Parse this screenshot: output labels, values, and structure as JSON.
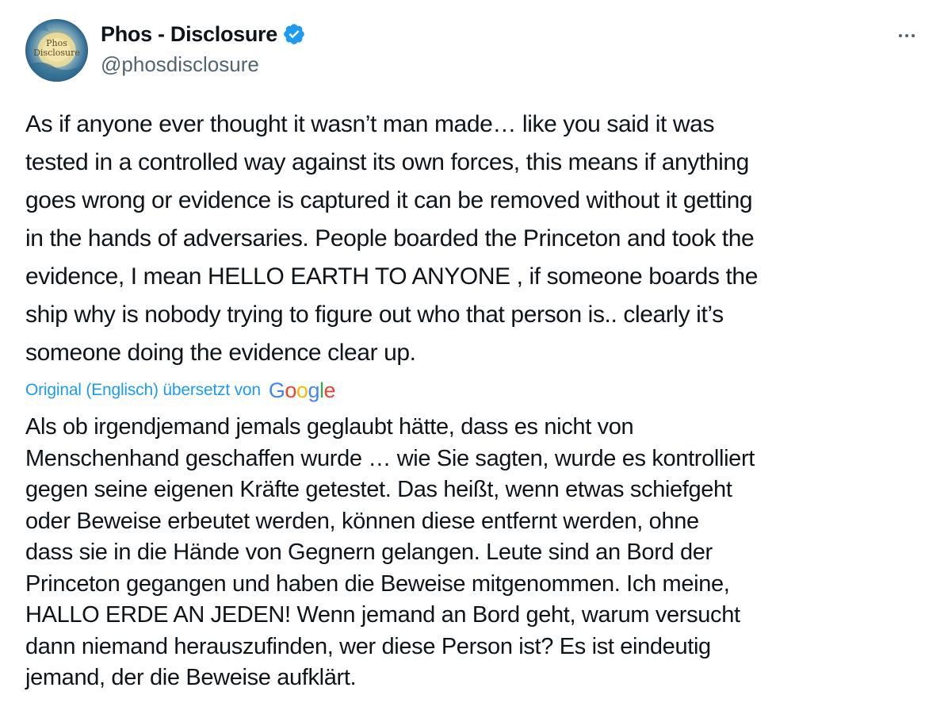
{
  "author": {
    "display_name": "Phos - Disclosure",
    "handle": "@phosdisclosure",
    "avatar_text_line1": "Phos",
    "avatar_text_line2": "Disclosure",
    "verified": true,
    "verified_icon": "verified-badge-icon",
    "verified_color": "#1d9bf0"
  },
  "menu": {
    "icon": "more-options-icon"
  },
  "tweet": {
    "original_text": "As if anyone ever thought it wasn’t man made… like you said it was\ntested in a controlled way against its own forces, this means if anything\ngoes wrong or evidence is captured it can be removed without it getting\nin the hands of adversaries. People boarded the Princeton and took the\nevidence, I mean HELLO EARTH TO ANYONE , if someone boards the\nship why is nobody trying to figure out who that person is.. clearly it’s\nsomeone doing the evidence clear up.",
    "translation_label": "Original (Englisch) übersetzt von",
    "translation_provider": [
      "G",
      "o",
      "o",
      "g",
      "l",
      "e"
    ],
    "translation_provider_colors": [
      "#4285f4",
      "#ea4335",
      "#fbbc05",
      "#4285f4",
      "#34a853",
      "#ea4335"
    ],
    "translated_text": "Als ob irgendjemand jemals geglaubt hätte, dass es nicht von\nMenschenhand geschaffen wurde … wie Sie sagten, wurde es kontrolliert\ngegen seine eigenen Kräfte getestet. Das heißt, wenn etwas schiefgeht\noder Beweise erbeutet werden, können diese entfernt werden, ohne\ndass sie in die Hände von Gegnern gelangen. Leute sind an Bord der\nPrinceton gegangen und haben die Beweise mitgenommen. Ich meine,\nHALLO ERDE AN JEDEN! Wenn jemand an Bord geht, warum versucht\ndann niemand herauszufinden, wer diese Person ist? Es ist eindeutig\njemand, der die Beweise aufklärt."
  }
}
